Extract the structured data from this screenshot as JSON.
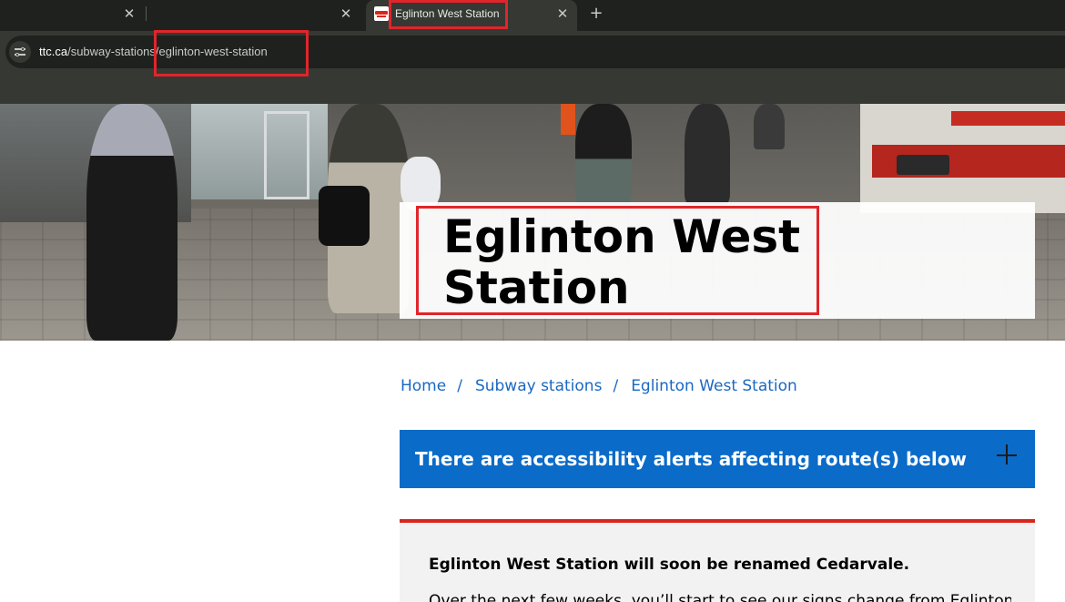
{
  "browser": {
    "tabs": [
      {
        "title": "",
        "close_glyph": "✕"
      },
      {
        "title": "",
        "close_glyph": "✕"
      },
      {
        "title": "Eglinton West Station",
        "close_glyph": "✕",
        "active": true
      }
    ],
    "new_tab_glyph": "+",
    "address": {
      "host": "ttc.ca",
      "path": "/subway-stations/eglinton-west-station"
    }
  },
  "hero": {
    "title": "Eglinton West Station"
  },
  "breadcrumb": {
    "items": [
      "Home",
      "Subway stations",
      "Eglinton West Station"
    ],
    "separator": "/"
  },
  "alert": {
    "text": "There are accessibility alerts affecting route(s) below",
    "expand_glyph": "+"
  },
  "notice": {
    "heading": "Eglinton West Station will soon be renamed Cedarvale.",
    "body": "Over the next few weeks, you’ll start to see our signs change from Eglinton"
  },
  "colors": {
    "brand_red": "#da251d",
    "link_blue": "#1a68c2",
    "alert_blue": "#0a6bc8",
    "annotation_red": "#e0252b"
  },
  "icons": {
    "site_info": "site-settings-icon",
    "favicon": "ttc-logo-icon",
    "expand": "plus-icon"
  }
}
